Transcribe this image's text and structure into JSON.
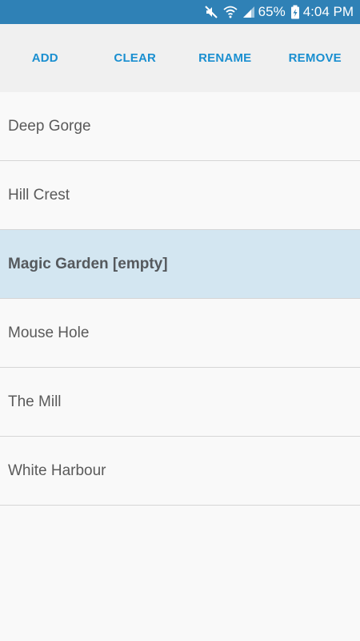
{
  "status_bar": {
    "battery_percent": "65%",
    "time": "4:04 PM",
    "icons": [
      "mute-icon",
      "wifi-icon",
      "signal-icon",
      "battery-charging-icon"
    ]
  },
  "toolbar": {
    "add_label": "ADD",
    "clear_label": "CLEAR",
    "rename_label": "RENAME",
    "remove_label": "REMOVE"
  },
  "list": {
    "items": [
      {
        "label": "Deep Gorge",
        "selected": false
      },
      {
        "label": "Hill Crest",
        "selected": false
      },
      {
        "label": "Magic Garden [empty]",
        "selected": true
      },
      {
        "label": "Mouse Hole",
        "selected": false
      },
      {
        "label": "The Mill",
        "selected": false
      },
      {
        "label": "White Harbour",
        "selected": false
      }
    ]
  },
  "colors": {
    "status_bar": "#2f81b6",
    "toolbar_bg": "#f0f0f0",
    "accent": "#1a8fd0",
    "selected_row": "#d3e6f1",
    "divider": "#d6d6d6",
    "text": "#5a5a5a"
  }
}
